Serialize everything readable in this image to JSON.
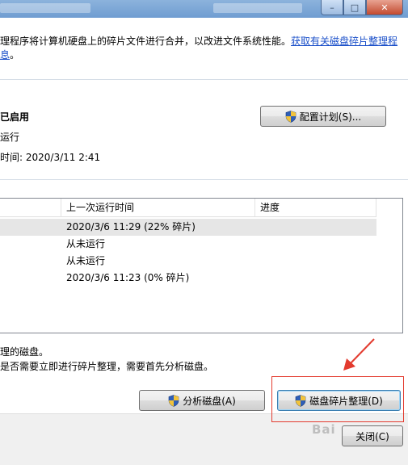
{
  "description": {
    "line1_prefix": "理程序将计算机硬盘上的碎片文件进行合并，以改进文件系统性能。",
    "line1_link": "获取有关磁盘碎片整理程",
    "line2_link": "息",
    "line2_suffix": "。"
  },
  "schedule": {
    "status": "已启用",
    "run": "运行",
    "next_run": "时间: 2020/3/11 2:41",
    "configure_button": "配置计划(S)..."
  },
  "disk_list": {
    "columns": [
      "上一次运行时间",
      "进度"
    ],
    "rows": [
      {
        "last_run": "2020/3/6 11:29 (22% 碎片)",
        "progress": ""
      },
      {
        "last_run": "从未运行",
        "progress": ""
      },
      {
        "last_run": "从未运行",
        "progress": ""
      },
      {
        "last_run": "2020/3/6 11:23 (0% 碎片)",
        "progress": ""
      }
    ]
  },
  "hint": {
    "line1": "理的磁盘。",
    "line2": "是否需要立即进行碎片整理，需要首先分析磁盘。"
  },
  "buttons": {
    "analyze": "分析磁盘(A)",
    "defrag": "磁盘碎片整理(D)",
    "close": "关闭(C)"
  },
  "watermark": "Bai"
}
